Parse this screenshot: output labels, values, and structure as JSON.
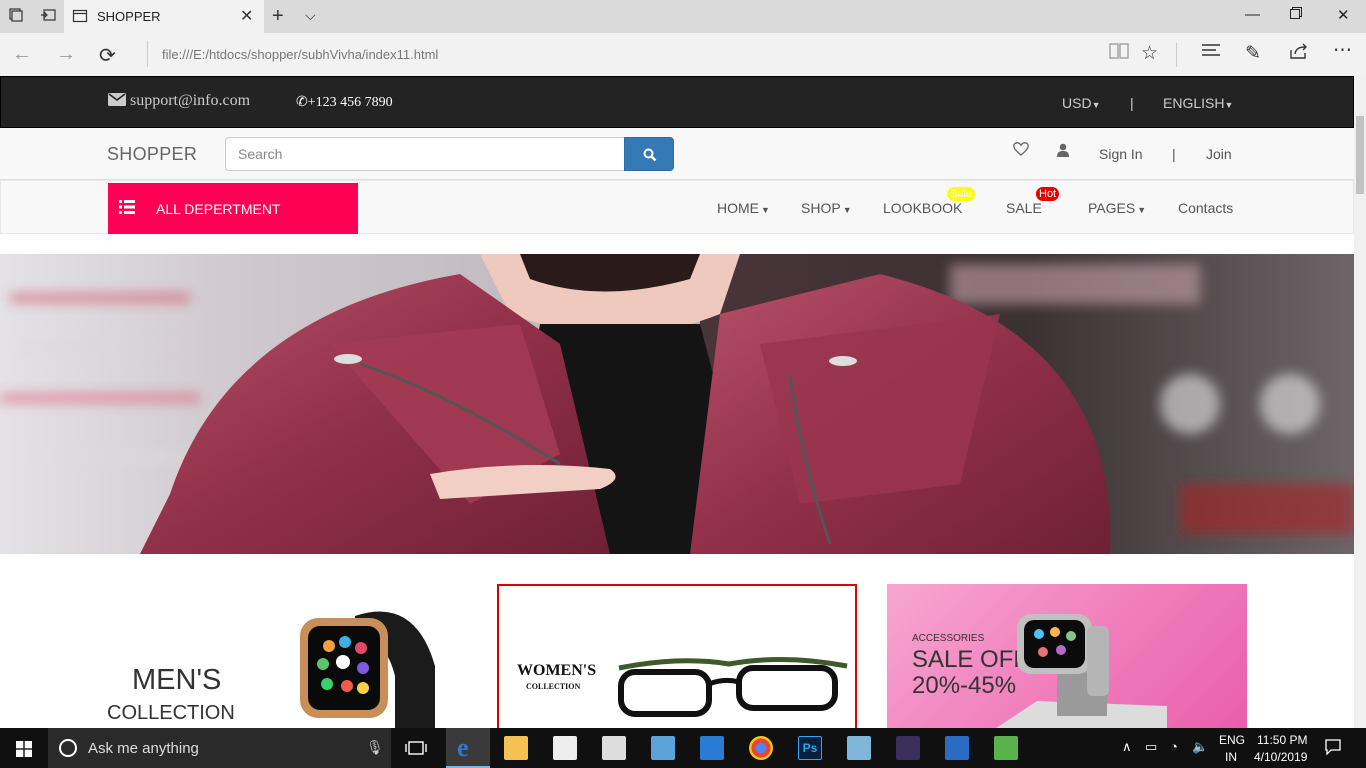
{
  "browser": {
    "tab_title": "SHOPPER",
    "url": "file:///E:/htdocs/shopper/subhVivha/index11.html"
  },
  "topbar": {
    "email": "support@info.com",
    "phone": "+123 456 7890",
    "currency": "USD",
    "separator": "|",
    "language": "ENGLISH"
  },
  "header": {
    "logo": "SHOPPER",
    "search_placeholder": "Search",
    "sign_in": "Sign In",
    "separator": "|",
    "join": "Join"
  },
  "navbar": {
    "department_label": "ALL DEPERTMENT",
    "items": [
      {
        "label": "HOME",
        "dropdown": true
      },
      {
        "label": "SHOP",
        "dropdown": true
      },
      {
        "label": "LOOKBOOK",
        "badge": "Sale"
      },
      {
        "label": "SALE",
        "badge": "Hot"
      },
      {
        "label": "PAGES",
        "dropdown": true
      },
      {
        "label": "Contacts"
      }
    ],
    "badge_colors": {
      "sale": "#ffff00",
      "hot": "#e60000"
    }
  },
  "banners": {
    "mens": {
      "title": "MEN'S",
      "subtitle": "COLLECTION"
    },
    "womens": {
      "title": "WOMEN'S",
      "subtitle": "COLLECTION"
    },
    "accessories": {
      "label": "ACCESSORIES",
      "title": "SALE OFF",
      "percent": "20%-45%"
    }
  },
  "taskbar": {
    "search_text": "Ask me anything",
    "lang_top": "ENG",
    "lang_bottom": "IN",
    "time": "11:50 PM",
    "date": "4/10/2019"
  },
  "colors": {
    "accent_pink": "#ff0055",
    "search_blue": "#337ab7",
    "topbar": "#232323"
  }
}
